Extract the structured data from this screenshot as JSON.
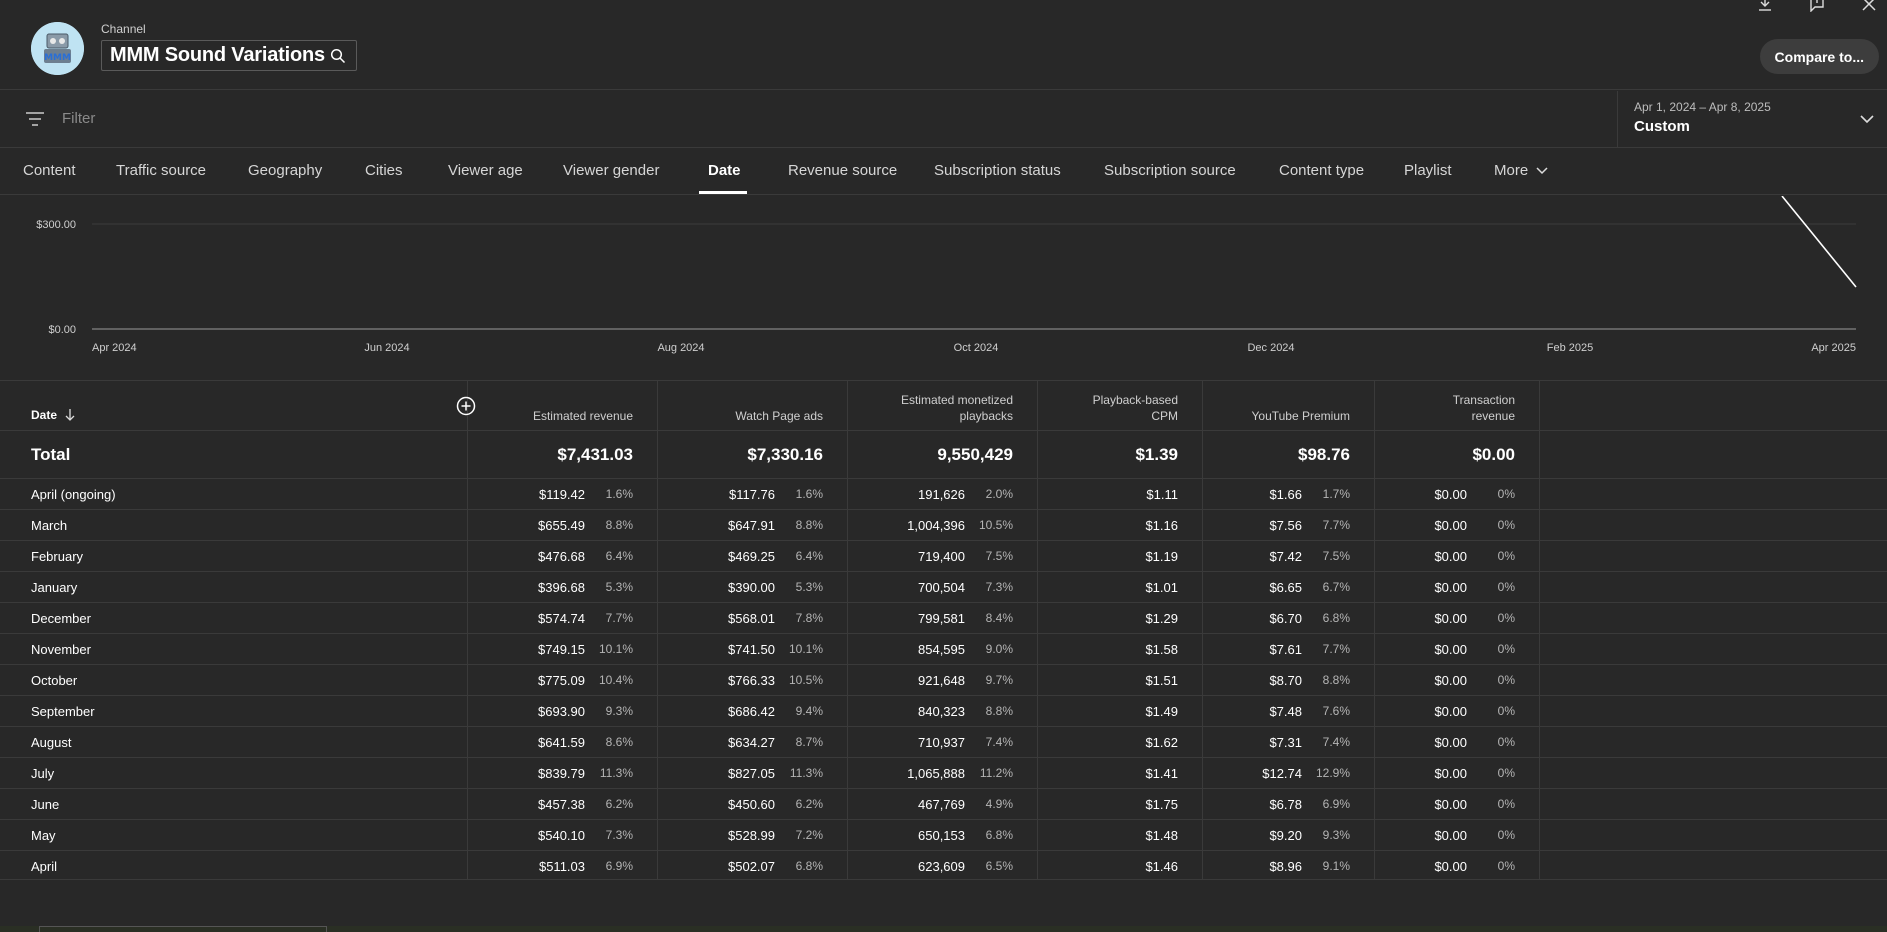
{
  "header": {
    "channel_label": "Channel",
    "channel_name": "MMM Sound Variations",
    "compare_label": "Compare to..."
  },
  "filter": {
    "placeholder": "Filter",
    "date_range": "Apr 1, 2024 – Apr 8, 2025",
    "date_preset": "Custom"
  },
  "tabs": [
    "Content",
    "Traffic source",
    "Geography",
    "Cities",
    "Viewer age",
    "Viewer gender",
    "Date",
    "Revenue source",
    "Subscription status",
    "Subscription source",
    "Content type",
    "Playlist",
    "More"
  ],
  "active_tab": "Date",
  "chart_data": {
    "type": "line",
    "y_ticks": [
      "$300.00",
      "$0.00"
    ],
    "x_ticks": [
      "Apr 2024",
      "Jun 2024",
      "Aug 2024",
      "Oct 2024",
      "Dec 2024",
      "Feb 2025",
      "Apr 2025"
    ],
    "grid": true
  },
  "table": {
    "headers": {
      "date": "Date",
      "est_revenue": "Estimated revenue",
      "watch_page_ads": "Watch Page ads",
      "monetized_playbacks_1": "Estimated monetized",
      "monetized_playbacks_2": "playbacks",
      "cpm_1": "Playback-based",
      "cpm_2": "CPM",
      "premium": "YouTube Premium",
      "transaction_1": "Transaction",
      "transaction_2": "revenue"
    },
    "total": {
      "label": "Total",
      "est_revenue": "$7,431.03",
      "watch_page_ads": "$7,330.16",
      "playbacks": "9,550,429",
      "cpm": "$1.39",
      "premium": "$98.76",
      "transaction": "$0.00"
    },
    "rows": [
      {
        "date": "April (ongoing)",
        "rev": "$119.42",
        "rev_pct": "1.6%",
        "ads": "$117.76",
        "ads_pct": "1.6%",
        "plays": "191,626",
        "plays_pct": "2.0%",
        "cpm": "$1.11",
        "prem": "$1.66",
        "prem_pct": "1.7%",
        "trans": "$0.00",
        "trans_pct": "0%"
      },
      {
        "date": "March",
        "rev": "$655.49",
        "rev_pct": "8.8%",
        "ads": "$647.91",
        "ads_pct": "8.8%",
        "plays": "1,004,396",
        "plays_pct": "10.5%",
        "cpm": "$1.16",
        "prem": "$7.56",
        "prem_pct": "7.7%",
        "trans": "$0.00",
        "trans_pct": "0%"
      },
      {
        "date": "February",
        "rev": "$476.68",
        "rev_pct": "6.4%",
        "ads": "$469.25",
        "ads_pct": "6.4%",
        "plays": "719,400",
        "plays_pct": "7.5%",
        "cpm": "$1.19",
        "prem": "$7.42",
        "prem_pct": "7.5%",
        "trans": "$0.00",
        "trans_pct": "0%"
      },
      {
        "date": "January",
        "rev": "$396.68",
        "rev_pct": "5.3%",
        "ads": "$390.00",
        "ads_pct": "5.3%",
        "plays": "700,504",
        "plays_pct": "7.3%",
        "cpm": "$1.01",
        "prem": "$6.65",
        "prem_pct": "6.7%",
        "trans": "$0.00",
        "trans_pct": "0%"
      },
      {
        "date": "December",
        "rev": "$574.74",
        "rev_pct": "7.7%",
        "ads": "$568.01",
        "ads_pct": "7.8%",
        "plays": "799,581",
        "plays_pct": "8.4%",
        "cpm": "$1.29",
        "prem": "$6.70",
        "prem_pct": "6.8%",
        "trans": "$0.00",
        "trans_pct": "0%"
      },
      {
        "date": "November",
        "rev": "$749.15",
        "rev_pct": "10.1%",
        "ads": "$741.50",
        "ads_pct": "10.1%",
        "plays": "854,595",
        "plays_pct": "9.0%",
        "cpm": "$1.58",
        "prem": "$7.61",
        "prem_pct": "7.7%",
        "trans": "$0.00",
        "trans_pct": "0%"
      },
      {
        "date": "October",
        "rev": "$775.09",
        "rev_pct": "10.4%",
        "ads": "$766.33",
        "ads_pct": "10.5%",
        "plays": "921,648",
        "plays_pct": "9.7%",
        "cpm": "$1.51",
        "prem": "$8.70",
        "prem_pct": "8.8%",
        "trans": "$0.00",
        "trans_pct": "0%"
      },
      {
        "date": "September",
        "rev": "$693.90",
        "rev_pct": "9.3%",
        "ads": "$686.42",
        "ads_pct": "9.4%",
        "plays": "840,323",
        "plays_pct": "8.8%",
        "cpm": "$1.49",
        "prem": "$7.48",
        "prem_pct": "7.6%",
        "trans": "$0.00",
        "trans_pct": "0%"
      },
      {
        "date": "August",
        "rev": "$641.59",
        "rev_pct": "8.6%",
        "ads": "$634.27",
        "ads_pct": "8.7%",
        "plays": "710,937",
        "plays_pct": "7.4%",
        "cpm": "$1.62",
        "prem": "$7.31",
        "prem_pct": "7.4%",
        "trans": "$0.00",
        "trans_pct": "0%"
      },
      {
        "date": "July",
        "rev": "$839.79",
        "rev_pct": "11.3%",
        "ads": "$827.05",
        "ads_pct": "11.3%",
        "plays": "1,065,888",
        "plays_pct": "11.2%",
        "cpm": "$1.41",
        "prem": "$12.74",
        "prem_pct": "12.9%",
        "trans": "$0.00",
        "trans_pct": "0%"
      },
      {
        "date": "June",
        "rev": "$457.38",
        "rev_pct": "6.2%",
        "ads": "$450.60",
        "ads_pct": "6.2%",
        "plays": "467,769",
        "plays_pct": "4.9%",
        "cpm": "$1.75",
        "prem": "$6.78",
        "prem_pct": "6.9%",
        "trans": "$0.00",
        "trans_pct": "0%"
      },
      {
        "date": "May",
        "rev": "$540.10",
        "rev_pct": "7.3%",
        "ads": "$528.99",
        "ads_pct": "7.2%",
        "plays": "650,153",
        "plays_pct": "6.8%",
        "cpm": "$1.48",
        "prem": "$9.20",
        "prem_pct": "9.3%",
        "trans": "$0.00",
        "trans_pct": "0%"
      },
      {
        "date": "April",
        "rev": "$511.03",
        "rev_pct": "6.9%",
        "ads": "$502.07",
        "ads_pct": "6.8%",
        "plays": "623,609",
        "plays_pct": "6.5%",
        "cpm": "$1.46",
        "prem": "$8.96",
        "prem_pct": "9.1%",
        "trans": "$0.00",
        "trans_pct": "0%"
      }
    ]
  }
}
